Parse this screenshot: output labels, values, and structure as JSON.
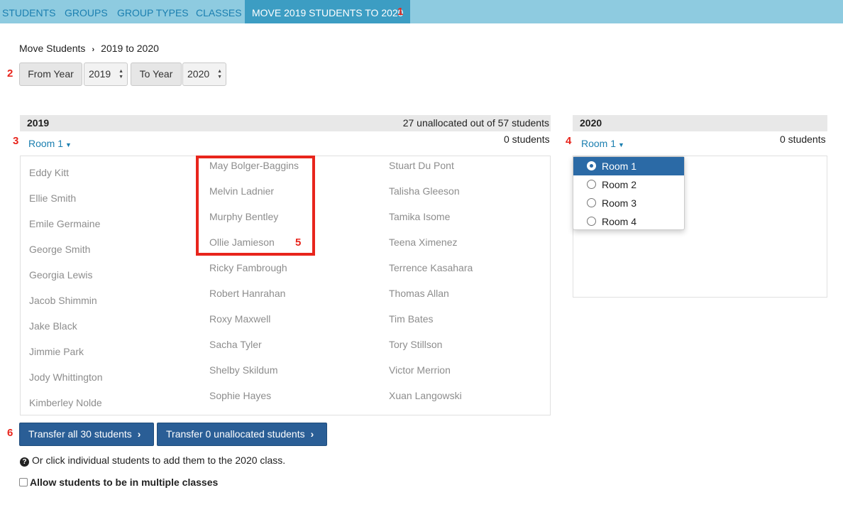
{
  "nav": {
    "items": [
      "STUDENTS",
      "GROUPS",
      "GROUP TYPES",
      "CLASSES"
    ],
    "active": "MOVE 2019 STUDENTS TO 2020"
  },
  "markers": [
    "1",
    "2",
    "3",
    "4",
    "5",
    "6"
  ],
  "breadcrumb": {
    "root": "Move Students",
    "separator": "›",
    "current": "2019 to 2020"
  },
  "year_selector": {
    "from_label": "From Year",
    "from_value": "2019",
    "to_label": "To Year",
    "to_value": "2020"
  },
  "left_panel": {
    "title": "2019",
    "summary": "27 unallocated out of 57 students",
    "room": "Room 1",
    "count": "0 students",
    "students_col1": [
      "Eddy Kitt",
      "Ellie Smith",
      "Emile Germaine",
      "George Smith",
      "Georgia Lewis",
      "Jacob Shimmin",
      "Jake Black",
      "Jimmie Park",
      "Jody Whittington",
      "Kimberley Nolde"
    ],
    "students_col2": [
      "May Bolger-Baggins",
      "Melvin Ladnier",
      "Murphy Bentley",
      "Ollie Jamieson",
      "Ricky Fambrough",
      "Robert Hanrahan",
      "Roxy Maxwell",
      "Sacha Tyler",
      "Shelby Skildum",
      "Sophie Hayes"
    ],
    "students_col3": [
      "Stuart Du Pont",
      "Talisha Gleeson",
      "Tamika Isome",
      "Teena Ximenez",
      "Terrence Kasahara",
      "Thomas Allan",
      "Tim Bates",
      "Tory Stillson",
      "Victor Merrion",
      "Xuan Langowski"
    ]
  },
  "right_panel": {
    "title": "2020",
    "room": "Room 1",
    "count": "0 students",
    "room_options": [
      "Room 1",
      "Room 2",
      "Room 3",
      "Room 4"
    ],
    "selected_room": "Room 1"
  },
  "actions": {
    "transfer_all": "Transfer all 30 students",
    "transfer_unallocated": "Transfer 0 unallocated students"
  },
  "help_text": "Or click individual students to add them to the 2020 class.",
  "allow_multiple_label": "Allow students to be in multiple classes",
  "colors": {
    "nav_bg": "#8ecbe0",
    "nav_active": "#3c9dc3",
    "link": "#1b7fb0",
    "primary_button": "#2a5e96",
    "marker": "#e8251c"
  }
}
